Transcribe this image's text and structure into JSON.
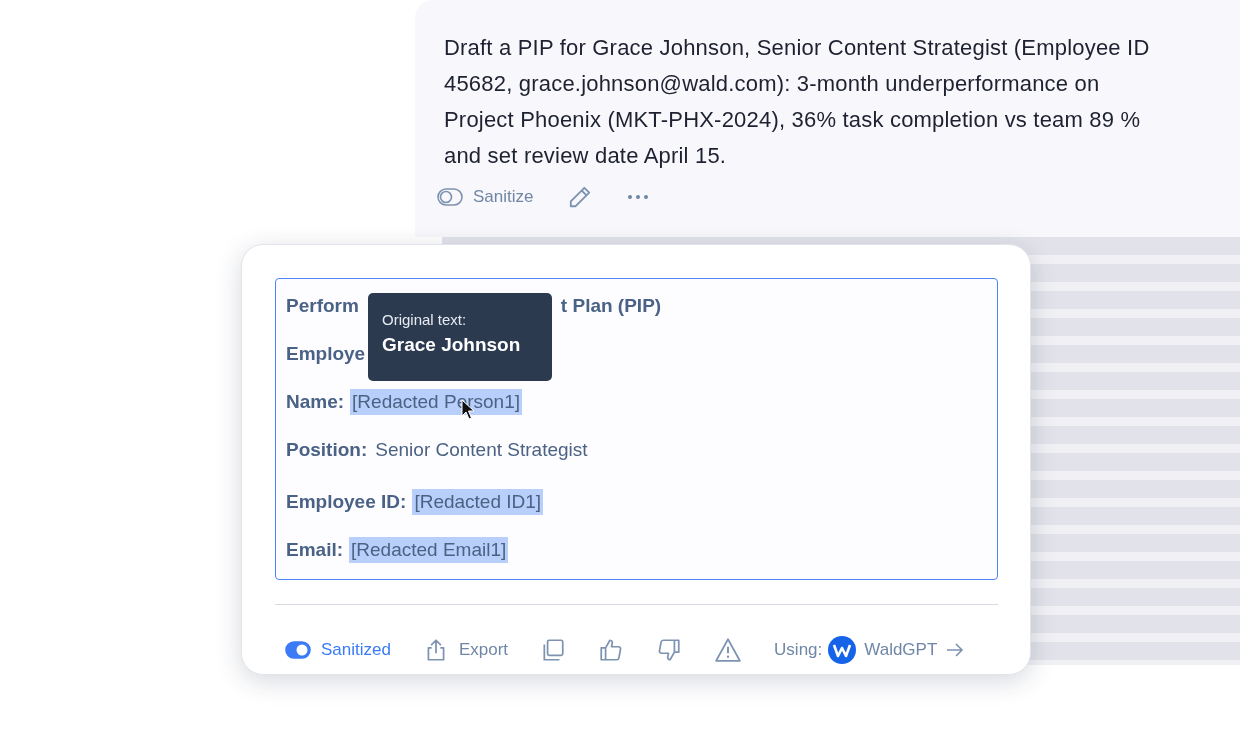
{
  "prompt": {
    "lines": [
      "Draft a PIP for Grace Johnson, Senior Content Strategist (Employee ID",
      "45682, grace.johnson@wald.com): 3-month underperformance on",
      "Project Phoenix (MKT-PHX-2024), 36% task completion vs team 89 %",
      "and set review date April 15."
    ],
    "sanitize": {
      "label": "Sanitize",
      "on": false
    }
  },
  "document": {
    "heading": [
      "Perform",
      "t Plan (PIP)"
    ],
    "section": "Employe",
    "fields": [
      {
        "label": "Name:",
        "value": "[Redacted Person1]",
        "redacted": true
      },
      {
        "label": "Position:",
        "value": "Senior Content Strategist",
        "redacted": false
      },
      {
        "label": "Employee ID:",
        "value": "[Redacted ID1]",
        "redacted": true
      },
      {
        "label": "Email:",
        "value": "[Redacted Email1]",
        "redacted": true
      }
    ]
  },
  "tooltip": {
    "title": "Original text:",
    "value": "Grace Johnson"
  },
  "footer": {
    "sanitized": {
      "label": "Sanitized",
      "on": true
    },
    "export": "Export",
    "using_label": "Using:",
    "model": "WaldGPT"
  }
}
